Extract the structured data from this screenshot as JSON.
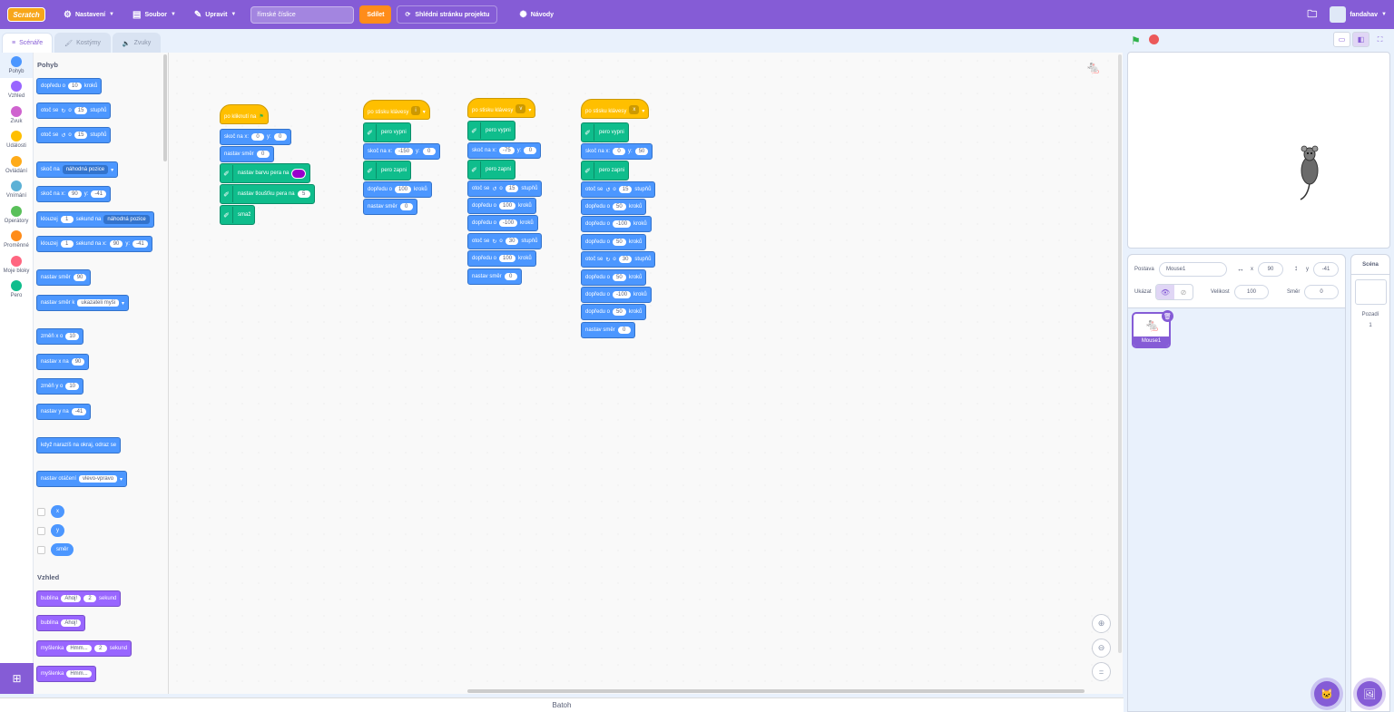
{
  "menubar": {
    "logo": "Scratch",
    "settings": "Nastavení",
    "file": "Soubor",
    "edit": "Upravit",
    "project_title": "římské číslice",
    "share": "Sdílet",
    "see_project": "Shlédni stránku projektu",
    "tutorials": "Návody",
    "username": "fandahav"
  },
  "tabs": {
    "code": "Scénáře",
    "costumes": "Kostýmy",
    "sounds": "Zvuky"
  },
  "categories": [
    {
      "label": "Pohyb",
      "color": "#4c97ff"
    },
    {
      "label": "Vzhled",
      "color": "#9966ff"
    },
    {
      "label": "Zvuk",
      "color": "#cf63cf"
    },
    {
      "label": "Události",
      "color": "#ffbf00"
    },
    {
      "label": "Ovládání",
      "color": "#ffab19"
    },
    {
      "label": "Vnímání",
      "color": "#5cb1d6"
    },
    {
      "label": "Operátory",
      "color": "#59c059"
    },
    {
      "label": "Proměnné",
      "color": "#ff8c1a"
    },
    {
      "label": "Moje bloky",
      "color": "#ff6680"
    },
    {
      "label": "Pero",
      "color": "#0fbd8c"
    }
  ],
  "palette": {
    "motion_head": "Pohyb",
    "looks_head": "Vzhled",
    "b1": {
      "a": "dopředu o",
      "v": "10",
      "b": "kroků"
    },
    "b2": {
      "a": "otoč se",
      "b": "o",
      "v": "15",
      "c": "stupňů"
    },
    "b3": {
      "a": "otoč se",
      "b": "o",
      "v": "15",
      "c": "stupňů"
    },
    "b4": {
      "a": "skoč na",
      "d": "náhodná pozice"
    },
    "b5": {
      "a": "skoč na x:",
      "x": "90",
      "y_lbl": "y:",
      "y": "-41"
    },
    "b6": {
      "a": "klouzej",
      "v": "1",
      "b": "sekund na",
      "d": "náhodná pozice"
    },
    "b7": {
      "a": "klouzej",
      "v": "1",
      "b": "sekund na x:",
      "x": "90",
      "y_lbl": "y:",
      "y": "-41"
    },
    "b8": {
      "a": "nastav směr",
      "v": "90"
    },
    "b9": {
      "a": "nastav směr k",
      "d": "ukazateli myši"
    },
    "b10": {
      "a": "změň x o",
      "v": "10"
    },
    "b11": {
      "a": "nastav x na",
      "v": "90"
    },
    "b12": {
      "a": "změň y o",
      "v": "10"
    },
    "b13": {
      "a": "nastav y na",
      "v": "-41"
    },
    "b14": {
      "a": "když narazíš na okraj, odraz se"
    },
    "b15": {
      "a": "nastav otáčení",
      "d": "vlevo-vpravo"
    },
    "r1": "x",
    "r2": "y",
    "r3": "směr",
    "l1": {
      "a": "bublina",
      "v": "Ahoj!",
      "v2": "2",
      "b": "sekund"
    },
    "l2": {
      "a": "bublina",
      "v": "Ahoj!"
    },
    "l3": {
      "a": "myšlenka",
      "v": "Hmm...",
      "v2": "2",
      "b": "sekund"
    },
    "l4": {
      "a": "myšlenka",
      "v": "Hmm..."
    }
  },
  "scripts": {
    "s1": {
      "hat": "po kliknutí na",
      "goto": "skoč na x:",
      "x": "0",
      "yl": "y:",
      "y": "0",
      "dir": "nastav směr",
      "dirv": "0",
      "color": "nastav barvu pera na",
      "size": "nastav tloušťku pera na",
      "sizev": "5",
      "clear": "smaž"
    },
    "s2": {
      "hat": "po stisku klávesy",
      "key": "i",
      "up": "pero vypni",
      "goto": "skoč na x:",
      "x": "-150",
      "yl": "y:",
      "y": "0",
      "down": "pero zapni",
      "mv": "dopředu o",
      "mvv": "100",
      "mvb": "kroků",
      "dir": "nastav směr",
      "dirv": "0"
    },
    "s3": {
      "hat": "po stisku klávesy",
      "key": "v",
      "up": "pero vypni",
      "goto": "skoč na x:",
      "x": "-75",
      "yl": "y:",
      "y": "0",
      "down": "pero zapni",
      "t1": "otoč se",
      "o": "o",
      "t1v": "15",
      "deg": "stupňů",
      "mv1": "dopředu o",
      "mv1v": "100",
      "kr": "kroků",
      "mv2": "dopředu o",
      "mv2v": "-100",
      "t2": "otoč se",
      "t2v": "30",
      "mv3": "dopředu o",
      "mv3v": "100",
      "dir": "nastav směr",
      "dirv": "0"
    },
    "s4": {
      "hat": "po stisku klávesy",
      "key": "x",
      "up": "pero vypni",
      "goto": "skoč na x:",
      "x": "0",
      "yl": "y:",
      "y": "50",
      "down": "pero zapni",
      "t1": "otoč se",
      "o": "o",
      "t1v": "15",
      "deg": "stupňů",
      "mv": "dopředu o",
      "kr": "kroků",
      "m1": "50",
      "m2": "-100",
      "m3": "50",
      "t2": "otoč se",
      "t2v": "30",
      "m4": "50",
      "m5": "-100",
      "m6": "50",
      "dir": "nastav směr",
      "dirv": "0"
    }
  },
  "backpack": "Batoh",
  "sprite": {
    "name_lbl": "Postava",
    "name": "Mouse1",
    "x_lbl": "x",
    "x": "90",
    "y_lbl": "y",
    "y": "-41",
    "show_lbl": "Ukázat",
    "size_lbl": "Velikost",
    "size": "100",
    "dir_lbl": "Směr",
    "dir": "0",
    "thumb_name": "Mouse1"
  },
  "scene": {
    "title": "Scéna",
    "backdrops_lbl": "Pozadí",
    "backdrops": "1"
  }
}
